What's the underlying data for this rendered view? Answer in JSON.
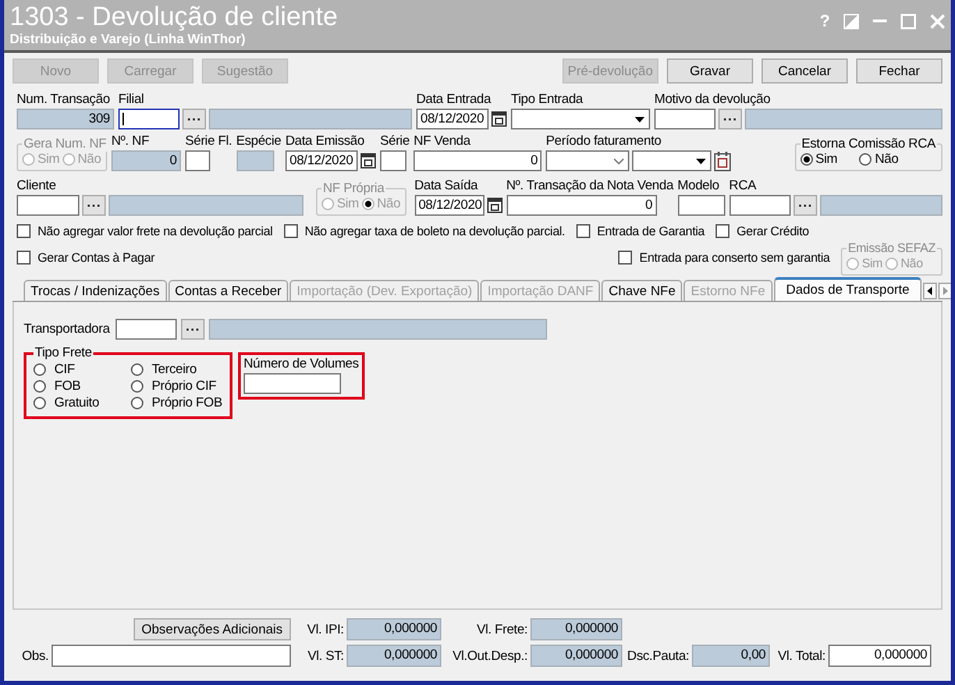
{
  "window": {
    "title": "1303 - Devolução de cliente",
    "subtitle": "Distribuição e Varejo (Linha WinThor)",
    "help": "?"
  },
  "toolbar": [
    {
      "label": "Novo",
      "disabled": true
    },
    {
      "label": "Carregar",
      "disabled": true
    },
    {
      "label": "Sugestão",
      "disabled": true
    },
    {
      "label": "Pré-devolução",
      "disabled": true
    },
    {
      "label": "Gravar",
      "disabled": false
    },
    {
      "label": "Cancelar",
      "disabled": false
    },
    {
      "label": "Fechar",
      "disabled": false
    }
  ],
  "header": {
    "num_transacao": {
      "label": "Num. Transação",
      "value": "309"
    },
    "filial": {
      "label": "Filial",
      "focused": true
    },
    "data_entrada": {
      "label": "Data Entrada",
      "value": "08/12/2020"
    },
    "tipo_entrada": {
      "label": "Tipo Entrada"
    },
    "motivo": {
      "label": "Motivo da devolução"
    },
    "gera_num_nf": {
      "label": "Gera Num. NF",
      "disabled": true,
      "options": [
        {
          "label": "Sim",
          "selected": false
        },
        {
          "label": "Não",
          "selected": false
        }
      ]
    },
    "num_nf": {
      "label": "Nº. NF",
      "value": "0"
    },
    "serie_fl": {
      "label": "Série Fl."
    },
    "especie": {
      "label": "Espécie"
    },
    "data_emissao": {
      "label": "Data Emissão",
      "value": "08/12/2020"
    },
    "serie": {
      "label": "Série"
    },
    "nf_venda": {
      "label": "NF Venda",
      "value": "0"
    },
    "periodo": {
      "label": "Período faturamento"
    },
    "estorna": {
      "label": "Estorna Comissão RCA",
      "disabled": false,
      "options": [
        {
          "label": "Sim",
          "selected": true
        },
        {
          "label": "Não",
          "selected": false
        }
      ]
    },
    "cliente": {
      "label": "Cliente"
    },
    "nf_propria": {
      "label": "NF Própria",
      "disabled": true,
      "options": [
        {
          "label": "Sim",
          "selected": false
        },
        {
          "label": "Não",
          "selected": true
        }
      ]
    },
    "data_saida": {
      "label": "Data Saída",
      "value": "08/12/2020"
    },
    "transacao_nota": {
      "label": "Nº. Transação da Nota Venda",
      "value": "0"
    },
    "modelo": {
      "label": "Modelo"
    },
    "rca": {
      "label": "RCA"
    }
  },
  "checkboxes": [
    {
      "label": "Não agregar valor frete na devolução parcial",
      "checked": false
    },
    {
      "label": "Não agregar taxa de boleto na devolução parcial.",
      "checked": false
    },
    {
      "label": "Entrada de Garantia",
      "checked": false
    },
    {
      "label": "Gerar Crédito",
      "checked": false
    },
    {
      "label": "Gerar Contas à Pagar",
      "checked": false
    },
    {
      "label": "Entrada para conserto sem garantia",
      "checked": false
    }
  ],
  "emissao_sefaz": {
    "label": "Emissão SEFAZ",
    "disabled": true,
    "options": [
      {
        "label": "Sim",
        "selected": false
      },
      {
        "label": "Não",
        "selected": false
      }
    ]
  },
  "tabs": [
    {
      "label": "Trocas / Indenizações",
      "selected": false,
      "disabled": false
    },
    {
      "label": "Contas a Receber",
      "selected": false,
      "disabled": false
    },
    {
      "label": "Importação (Dev. Exportação)",
      "selected": false,
      "disabled": true
    },
    {
      "label": "Importação DANF",
      "selected": false,
      "disabled": true
    },
    {
      "label": "Chave NFe",
      "selected": false,
      "disabled": false
    },
    {
      "label": "Estorno NFe",
      "selected": false,
      "disabled": true
    },
    {
      "label": "Dados de Transporte",
      "selected": true,
      "disabled": false
    }
  ],
  "transport": {
    "transportadora": {
      "label": "Transportadora"
    },
    "tipo_frete": {
      "label": "Tipo Frete",
      "highlighted": true,
      "options": [
        {
          "label": "CIF",
          "selected": false
        },
        {
          "label": "FOB",
          "selected": false
        },
        {
          "label": "Gratuito",
          "selected": false
        },
        {
          "label": "Terceiro",
          "selected": false
        },
        {
          "label": "Próprio CIF",
          "selected": false
        },
        {
          "label": "Próprio FOB",
          "selected": false
        }
      ]
    },
    "volumes": {
      "label": "Número de Volumes",
      "highlighted": true
    }
  },
  "totals": {
    "obs_button": "Observações Adicionais",
    "obs": {
      "label": "Obs."
    },
    "fields": [
      {
        "label": "Vl. IPI:",
        "value": "0,000000",
        "kind": "readonly"
      },
      {
        "label": "Vl. Frete:",
        "value": "0,000000",
        "kind": "readonly"
      },
      {
        "label": "Vl. ST:",
        "value": "0,000000",
        "kind": "readonly"
      },
      {
        "label": "Vl.Out.Desp.:",
        "value": "0,000000",
        "kind": "readonly"
      },
      {
        "label": "Dsc.Pauta:",
        "value": "0,00",
        "kind": "readonly"
      },
      {
        "label": "Vl. Total:",
        "value": "0,000000",
        "kind": "editable"
      }
    ]
  }
}
